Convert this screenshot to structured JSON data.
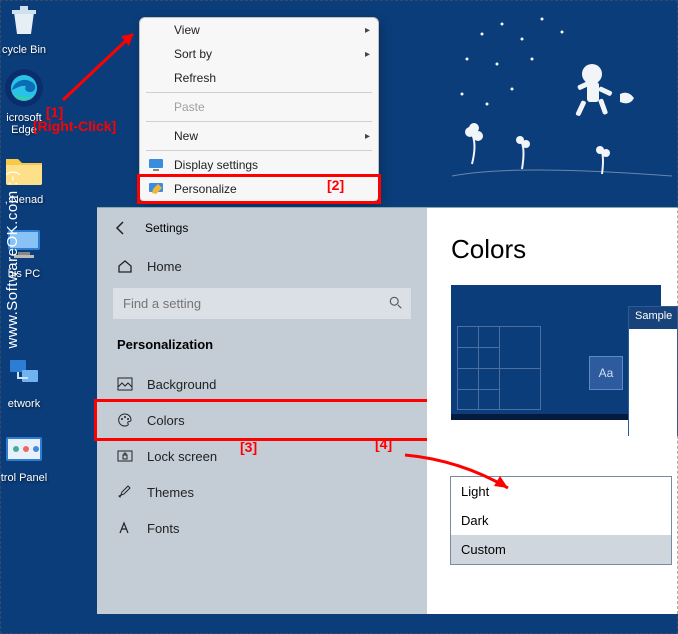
{
  "desktop": {
    "icons": {
      "recycle": "cycle Bin",
      "edge": "icrosoft\nEdge",
      "folder": ", Nenad",
      "thispc": "his PC",
      "network": "etwork",
      "cpanel": "trol Panel"
    }
  },
  "context_menu": {
    "view": "View",
    "sort": "Sort by",
    "refresh": "Refresh",
    "paste": "Paste",
    "new": "New",
    "display": "Display settings",
    "personalize": "Personalize"
  },
  "annotations": {
    "a1n": "[1]",
    "a1t": "[Right-Click]",
    "a2": "[2]",
    "a3": "[3]",
    "a4": "[4]"
  },
  "settings": {
    "title": "Settings",
    "home": "Home",
    "search_placeholder": "Find a setting",
    "heading": "Personalization",
    "items": {
      "background": "Background",
      "colors": "Colors",
      "lock": "Lock screen",
      "themes": "Themes",
      "fonts": "Fonts"
    },
    "page_title": "Colors",
    "preview_aa": "Aa",
    "sample": "Sample",
    "color_options": [
      "Light",
      "Dark",
      "Custom"
    ]
  },
  "watermark": "www.SoftwareOK.com :-)"
}
